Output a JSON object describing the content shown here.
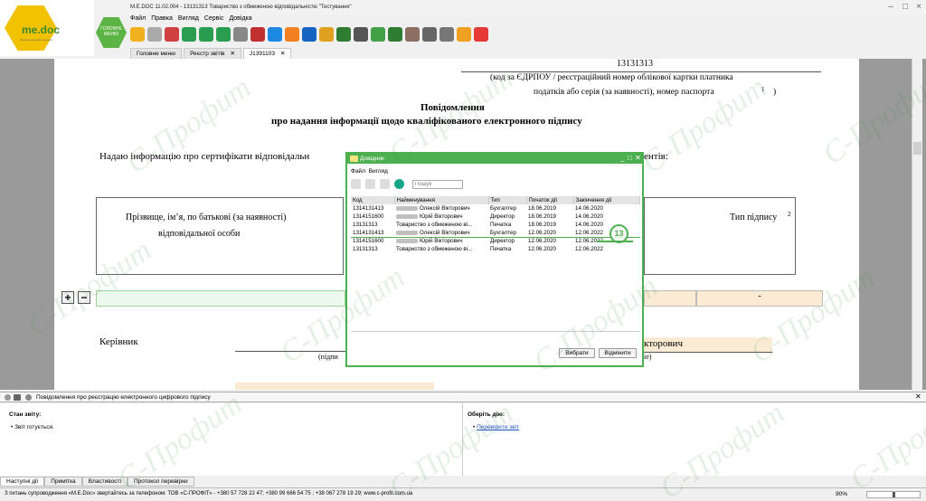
{
  "window": {
    "title": "M.E.DOC 11.02.004 - 13131313 Товариство з обмеженою відповідальністю \"Тестування\""
  },
  "logo": {
    "text": "me.doc",
    "sub": "мій електронний документ"
  },
  "main_menu_label": "ГОЛОВНЕ МЕНЮ",
  "menu": [
    "Файл",
    "Правка",
    "Вигляд",
    "Сервіс",
    "Довідка"
  ],
  "toolbar_icons": [
    "new-doc-icon",
    "copy-icon",
    "delete-icon",
    "export-icon",
    "import-icon",
    "add-icon",
    "search-icon",
    "clear-icon",
    "sign-icon",
    "send-icon",
    "print-icon",
    "archive-icon",
    "key-icon",
    "find-icon",
    "check-icon",
    "refresh-icon",
    "book-icon",
    "stamp-icon",
    "settings-icon",
    "help-icon",
    "chat-icon"
  ],
  "tabs": [
    {
      "label": "Головне меню",
      "closable": false,
      "active": false
    },
    {
      "label": "Реєстр звітів",
      "closable": true,
      "active": false
    },
    {
      "label": "J1391103",
      "closable": true,
      "active": true
    }
  ],
  "document": {
    "code": "13131313",
    "code_note_1": "(код за ЄДРПОУ / реєстраційний номер облікової картки платника",
    "code_note_2": "податків або серія (за наявності), номер паспорта",
    "footnote_1": "1",
    "close_paren": ")",
    "heading_1": "Повідомлення",
    "heading_2": "про надання інформації щодо кваліфікованого електронного підпису",
    "intro": "Надаю інформацію про сертифікати відповідальн",
    "intro_end": "ентів:",
    "col_name_1": "Прізвище, ім’я, по батькові (за наявності)",
    "col_name_2": "відповідальної особи",
    "col_sign_type": "Тип підпису",
    "footnote_2": "2",
    "row_dash": "-",
    "plus": "+",
    "minus": "−",
    "head_label": "Керівник",
    "head_name_tail": "кторович",
    "sign_hint_left": "(підпи",
    "sign_hint_right": "іе)"
  },
  "dialog": {
    "title": "Довідник",
    "menu": [
      "Файл",
      "Вигляд"
    ],
    "search_placeholder": "Пошук",
    "columns": [
      "Код",
      "Найменування",
      "Тип",
      "Початок дії",
      "Закінчення дії"
    ],
    "rows": [
      {
        "code": "1314131413",
        "name": "Олексій Вікторович",
        "blurred": true,
        "type": "Бухгалтер",
        "start": "18.06.2019",
        "end": "14.06.2020",
        "highlight": false
      },
      {
        "code": "1314151600",
        "name": "Юрій Вікторович",
        "blurred": true,
        "type": "Директор",
        "start": "18.06.2019",
        "end": "14.06.2020",
        "highlight": false
      },
      {
        "code": "13131313",
        "name": "Товариство з обмеженою ві...",
        "blurred": false,
        "type": "Печатка",
        "start": "18.06.2019",
        "end": "14.06.2020",
        "highlight": false
      },
      {
        "code": "1314131413",
        "name": "Олексій Вікторович",
        "blurred": true,
        "type": "Бухгалтер",
        "start": "12.06.2020",
        "end": "12.06.2022",
        "highlight": true
      },
      {
        "code": "1314151600",
        "name": "Юрій Вікторович",
        "blurred": true,
        "type": "Директор",
        "start": "12.06.2020",
        "end": "12.06.2022",
        "highlight": false
      },
      {
        "code": "13131313",
        "name": "Товариство з обмеженою ві...",
        "blurred": false,
        "type": "Печатка",
        "start": "12.06.2020",
        "end": "12.06.2022",
        "highlight": false
      }
    ],
    "step_badge": "13",
    "select_label": "Вибрати",
    "cancel_label": "Відмінити"
  },
  "infobar": {
    "text": "Повідомлення про реєстрацію електронного цифрового підпису"
  },
  "left_panel": {
    "title": "Стан звіту:",
    "item": "Звіт готується."
  },
  "right_panel": {
    "title": "Оберіть дію:",
    "item": "Перевірити звіт"
  },
  "bottom_tabs": [
    "Наступні дії",
    "Примітка",
    "Властивості",
    "Протокол перевірки"
  ],
  "status": {
    "text": "З питань супроводження «M.E.Doc» звертайтесь за телефоном: ТОВ «С-ПРОФІТ» - +380 57 728 22 47; +380 99 666 54 75 ; +38 067 278 19 29; www.c-profit.com.ua",
    "zoom": "90%"
  },
  "watermark": "С-Профит",
  "colors": {
    "accent": "#4caf50",
    "brand_yellow": "#f2c200",
    "highlight_row": "#fbebd4"
  }
}
